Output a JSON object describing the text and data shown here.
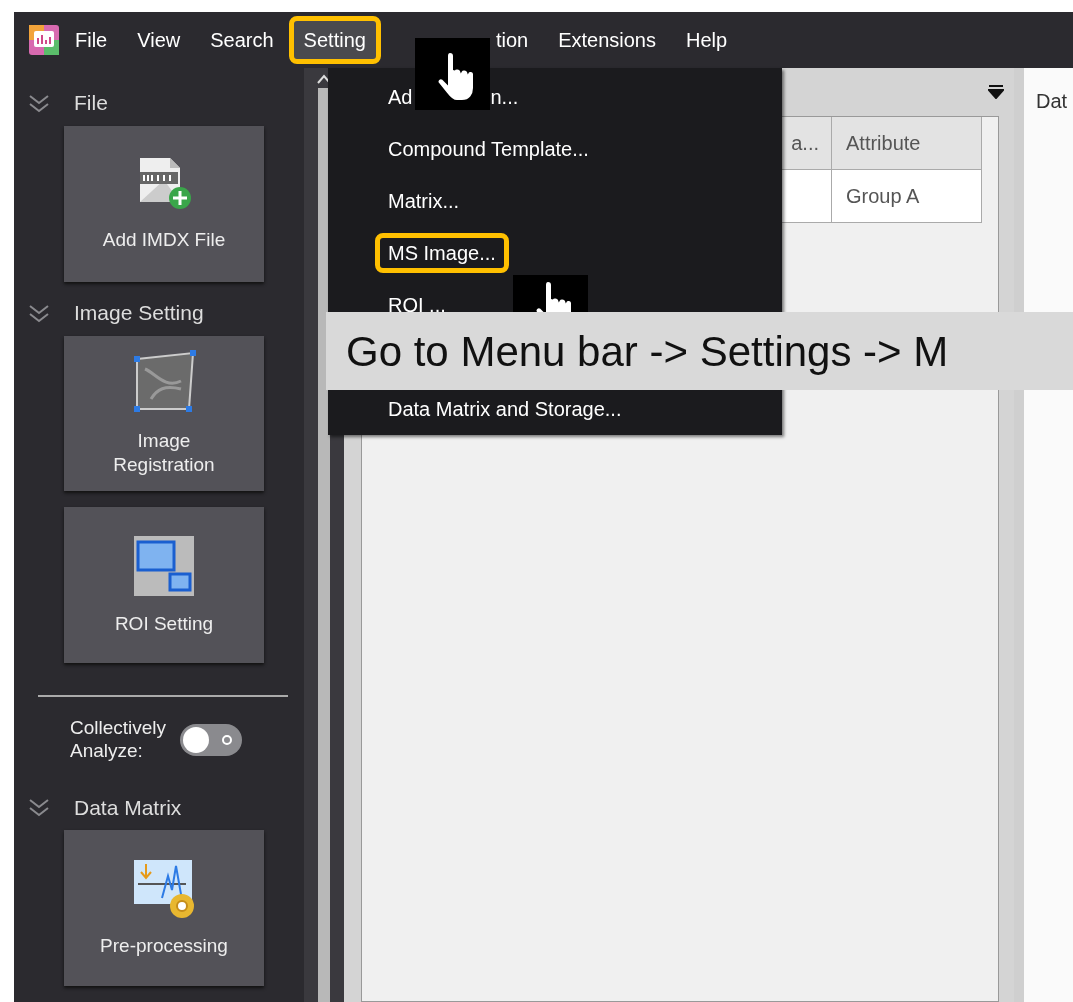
{
  "menu_bar": {
    "items": [
      {
        "label": "File",
        "highlighted": false
      },
      {
        "label": "View",
        "highlighted": false
      },
      {
        "label": "Search",
        "highlighted": false
      },
      {
        "label": "Setting",
        "highlighted": true,
        "open": true
      },
      {
        "label": "tion",
        "highlighted": false
      },
      {
        "label": "Extensions",
        "highlighted": false
      },
      {
        "label": "Help",
        "highlighted": false
      }
    ]
  },
  "dropdown": {
    "items": [
      {
        "label": "Ad",
        "label_after": "n...",
        "highlighted": false
      },
      {
        "label": "Compound Template...",
        "highlighted": false
      },
      {
        "label": "Matrix...",
        "highlighted": false
      },
      {
        "label": "MS Image...",
        "highlighted": true
      },
      {
        "label": "ROI ...",
        "highlighted": false
      },
      {
        "label": "Data Matrix and Storage...",
        "highlighted": false
      }
    ]
  },
  "sidebar": {
    "groups": [
      {
        "kind": "section",
        "title": "File",
        "tiles": [
          {
            "kind": "file-add",
            "label": "Add IMDX File"
          }
        ]
      },
      {
        "kind": "section",
        "title": "Image Setting",
        "tiles": [
          {
            "kind": "registration",
            "label": "Image\nRegistration"
          },
          {
            "kind": "roi",
            "label": "ROI Setting"
          }
        ]
      },
      {
        "kind": "toggle",
        "label": "Collectively\nAnalyze:",
        "on": false
      },
      {
        "kind": "section",
        "title": "Data Matrix",
        "tiles": [
          {
            "kind": "preprocess",
            "label": "Pre-processing"
          }
        ]
      }
    ]
  },
  "table": {
    "columns": [
      "a...",
      "Attribute"
    ],
    "rows": [
      [
        "",
        "Group A"
      ]
    ]
  },
  "right_panel": {
    "tab": "Dat"
  },
  "caption": "Go to Menu bar -> Settings -> M"
}
